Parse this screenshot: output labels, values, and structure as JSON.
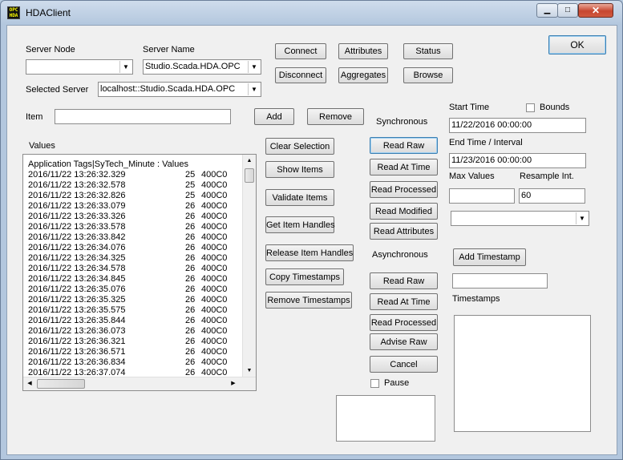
{
  "window": {
    "title": "HDAClient",
    "icon_text": "OPC HDA"
  },
  "labels": {
    "server_node": "Server Node",
    "server_name": "Server Name",
    "selected_server": "Selected Server",
    "item": "Item",
    "values": "Values",
    "synchronous": "Synchronous",
    "asynchronous": "Asynchronous",
    "start_time": "Start Time",
    "bounds": "Bounds",
    "end_time": "End Time / Interval",
    "max_values": "Max Values",
    "resample_int": "Resample Int.",
    "timestamps": "Timestamps",
    "pause": "Pause"
  },
  "fields": {
    "server_node": "",
    "server_name": "Studio.Scada.HDA.OPC",
    "selected_server": "localhost::Studio.Scada.HDA.OPC",
    "item": "",
    "start_time": "11/22/2016 00:00:00",
    "end_time": "11/23/2016 00:00:00",
    "max_values": "",
    "resample_int": "60",
    "aggregate_combo": "",
    "add_timestamp_field": ""
  },
  "buttons": {
    "connect": "Connect",
    "disconnect": "Disconnect",
    "attributes": "Attributes",
    "aggregates": "Aggregates",
    "status": "Status",
    "browse": "Browse",
    "ok": "OK",
    "add": "Add",
    "remove": "Remove",
    "clear_selection": "Clear Selection",
    "show_items": "Show Items",
    "validate_items": "Validate Items",
    "get_item_handles": "Get Item Handles",
    "release_item_handles": "Release Item Handles",
    "copy_timestamps": "Copy Timestamps",
    "remove_timestamps": "Remove Timestamps",
    "sync_read_raw": "Read Raw",
    "sync_read_at_time": "Read At Time",
    "sync_read_processed": "Read Processed",
    "sync_read_modified": "Read Modified",
    "sync_read_attributes": "Read Attributes",
    "async_read_raw": "Read Raw",
    "async_read_at_time": "Read At Time",
    "async_read_processed": "Read Processed",
    "async_advise_raw": "Advise Raw",
    "async_cancel": "Cancel",
    "add_timestamp": "Add Timestamp"
  },
  "values_list": {
    "header": "Application Tags|SyTech_Minute : Values",
    "rows": [
      [
        "2016/11/22 13:26:32.329",
        "25",
        "400C0"
      ],
      [
        "2016/11/22 13:26:32.578",
        "25",
        "400C0"
      ],
      [
        "2016/11/22 13:26:32.826",
        "25",
        "400C0"
      ],
      [
        "2016/11/22 13:26:33.079",
        "26",
        "400C0"
      ],
      [
        "2016/11/22 13:26:33.326",
        "26",
        "400C0"
      ],
      [
        "2016/11/22 13:26:33.578",
        "26",
        "400C0"
      ],
      [
        "2016/11/22 13:26:33.842",
        "26",
        "400C0"
      ],
      [
        "2016/11/22 13:26:34.076",
        "26",
        "400C0"
      ],
      [
        "2016/11/22 13:26:34.325",
        "26",
        "400C0"
      ],
      [
        "2016/11/22 13:26:34.578",
        "26",
        "400C0"
      ],
      [
        "2016/11/22 13:26:34.845",
        "26",
        "400C0"
      ],
      [
        "2016/11/22 13:26:35.076",
        "26",
        "400C0"
      ],
      [
        "2016/11/22 13:26:35.325",
        "26",
        "400C0"
      ],
      [
        "2016/11/22 13:26:35.575",
        "26",
        "400C0"
      ],
      [
        "2016/11/22 13:26:35.844",
        "26",
        "400C0"
      ],
      [
        "2016/11/22 13:26:36.073",
        "26",
        "400C0"
      ],
      [
        "2016/11/22 13:26:36.321",
        "26",
        "400C0"
      ],
      [
        "2016/11/22 13:26:36.571",
        "26",
        "400C0"
      ],
      [
        "2016/11/22 13:26:36.834",
        "26",
        "400C0"
      ],
      [
        "2016/11/22 13:26:37.074",
        "26",
        "400C0"
      ]
    ]
  },
  "icons": {
    "minimize": "minimize-icon",
    "maximize": "maximize-icon",
    "close": "close-icon",
    "dropdown": "chevron-down-icon"
  }
}
